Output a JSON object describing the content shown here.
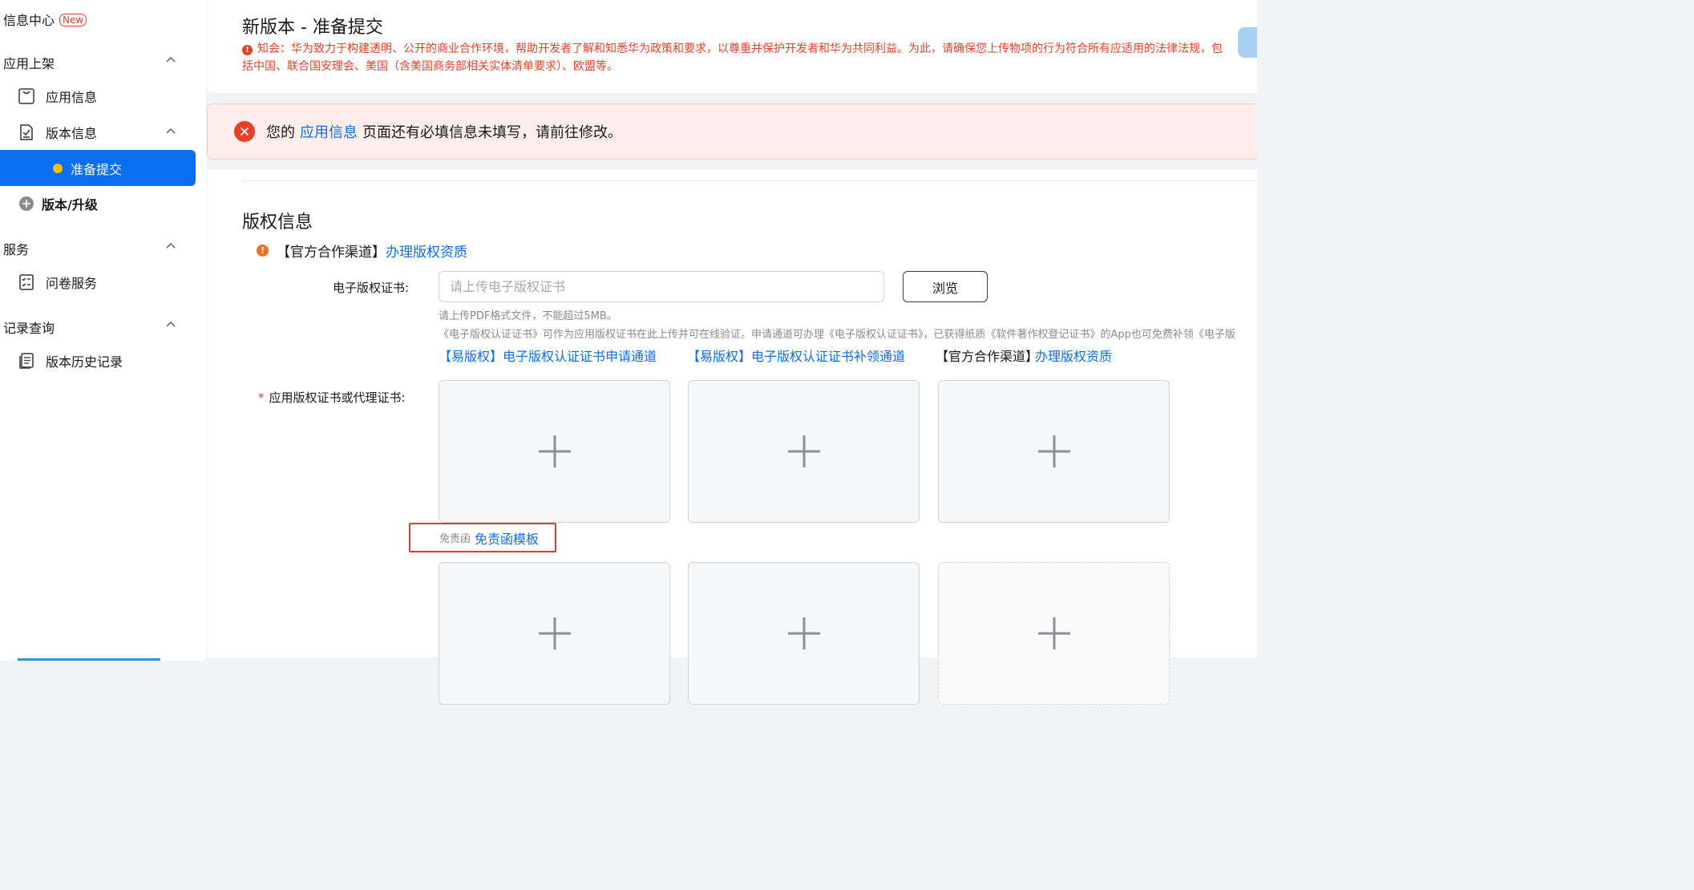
{
  "sidebar": {
    "info_center": "信息中心",
    "new_badge": "New",
    "group_app_release": "应用上架",
    "app_info": "应用信息",
    "version_info": "版本信息",
    "prepare_submit": "准备提交",
    "version_upgrade": "版本/升级",
    "group_service": "服务",
    "survey_service": "问卷服务",
    "group_records": "记录查询",
    "version_history": "版本历史记录",
    "accent_color": "#0a6ef2"
  },
  "header": {
    "title": "新版本 - 准备提交",
    "notice": "知会：华为致力于构建透明、公开的商业合作环境，帮助开发者了解和知悉华为政策和要求，以尊重并保护开发者和华为共同利益。为此，请确保您上传物项的行为符合所有应适用的法律法规，包括中国、联合国安理会、美国（含美国商务部相关实体清单要求）、欧盟等。"
  },
  "error_banner": {
    "prefix": "您的",
    "link": "应用信息",
    "suffix": "页面还有必填信息未填写，请前往修改。"
  },
  "copyright": {
    "section_title": "版权信息",
    "official_channel_label": "【官方合作渠道】",
    "official_channel_link": "办理版权资质",
    "ecert_label": "电子版权证书:",
    "ecert_placeholder": "请上传电子版权证书",
    "browse_button": "浏览",
    "hint_format": "请上传PDF格式文件，不能超过5MB。",
    "hint_desc": "《电子版权认证证书》可作为应用版权证书在此上传并可在线验证。申请通道可办理《电子版权认证证书》，已获得纸质《软件著作权登记证书》的App也可免费补领《电子版",
    "link_apply": "【易版权】电子版权认证证书申请通道",
    "link_reissue": "【易版权】电子版权认证证书补领通道",
    "link_official_bracket": "【官方合作渠道】",
    "link_official": "办理版权资质",
    "cert_label": "应用版权证书或代理证书:",
    "required_mark": "*",
    "disclaimer_small": "免责函",
    "disclaimer_link": "免责函模板"
  }
}
